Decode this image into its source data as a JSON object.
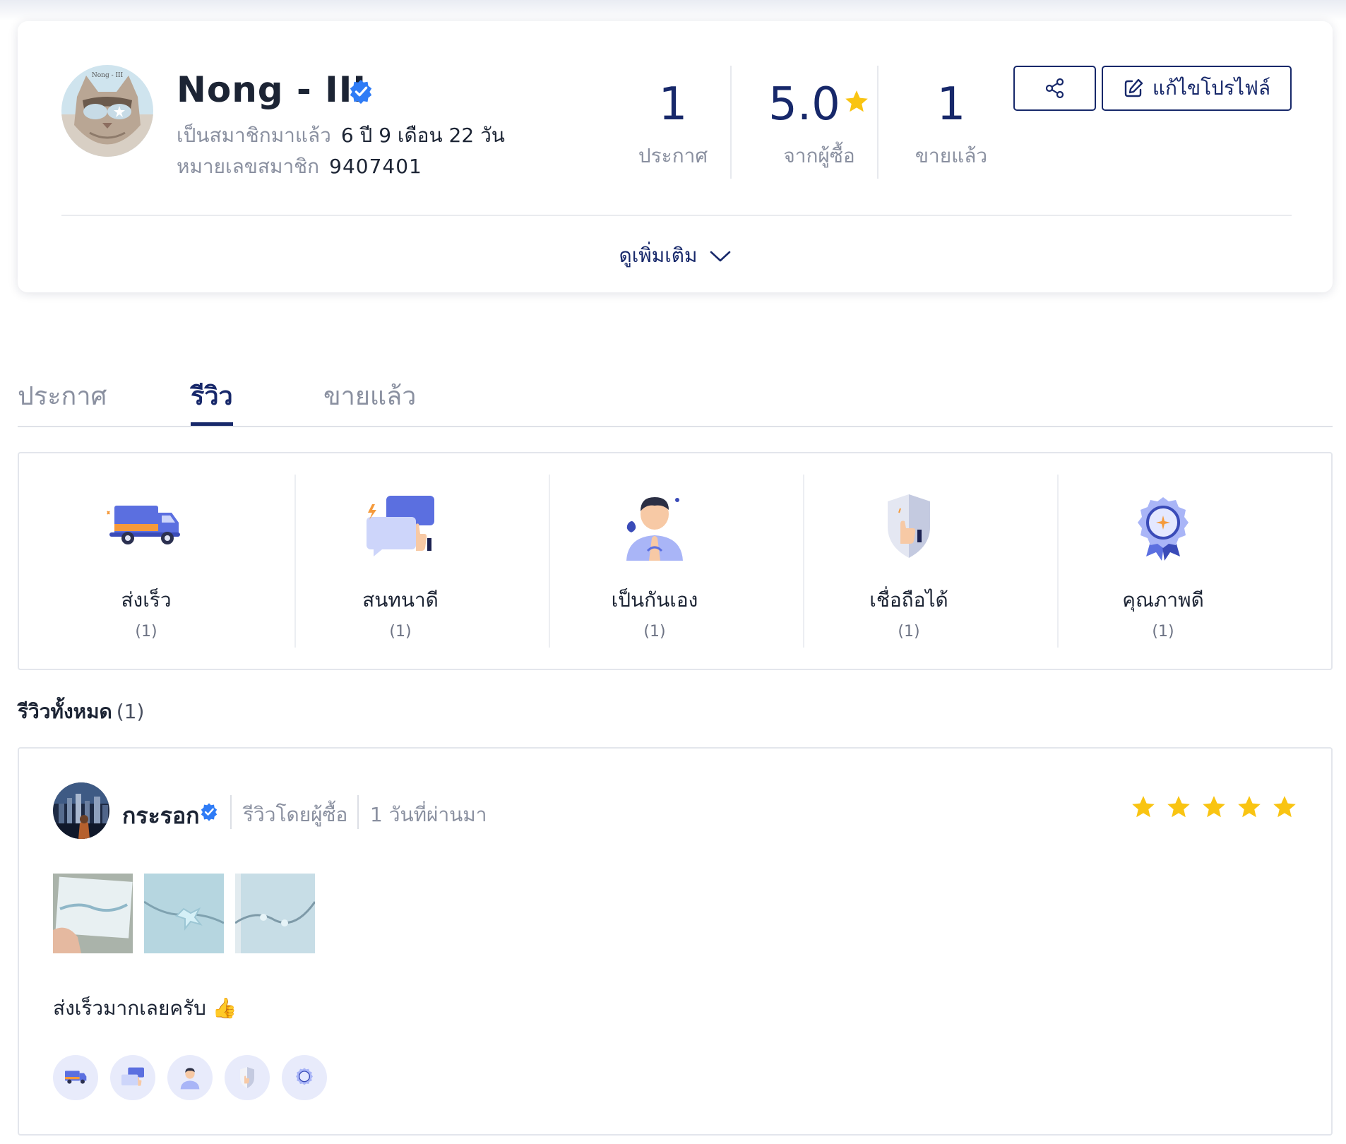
{
  "profile": {
    "name": "Nong - III",
    "avatar_text": "Nong - III",
    "member_since_label": "เป็นสมาชิกมาแล้ว",
    "member_since_value": "6 ปี 9 เดือน 22 วัน",
    "member_id_label": "หมายเลขสมาชิก",
    "member_id_value": "9407401",
    "stats": [
      {
        "value": "1",
        "label": "ประกาศ"
      },
      {
        "value": "5.0",
        "label": "จากผู้ซื้อ"
      },
      {
        "value": "1",
        "label": "ขายแล้ว"
      }
    ],
    "edit_label": "แก้ไขโปรไฟล์",
    "see_more_label": "ดูเพิ่มเติม"
  },
  "tabs": [
    {
      "label": "ประกาศ",
      "active": false
    },
    {
      "label": "รีวิว",
      "active": true
    },
    {
      "label": "ขายแล้ว",
      "active": false
    }
  ],
  "attributes": [
    {
      "name": "ส่งเร็ว",
      "count": "(1)",
      "icon": "delivery-truck-icon"
    },
    {
      "name": "สนทนาดี",
      "count": "(1)",
      "icon": "chat-thumbs-up-icon"
    },
    {
      "name": "เป็นกันเอง",
      "count": "(1)",
      "icon": "friendly-person-icon"
    },
    {
      "name": "เชื่อถือได้",
      "count": "(1)",
      "icon": "shield-thumbs-up-icon"
    },
    {
      "name": "คุณภาพดี",
      "count": "(1)",
      "icon": "quality-badge-icon"
    }
  ],
  "reviews": {
    "title": "รีวิวทั้งหมด",
    "count": "(1)",
    "items": [
      {
        "reviewer": "กระรอก",
        "reviewed_by": "รีวิวโดยผู้ซื้อ",
        "time": "1 วันที่ผ่านมา",
        "rating": 5,
        "text": "ส่งเร็วมากเลยครับ 👍",
        "photo_count": 3,
        "tags": [
          "delivery-truck-icon",
          "chat-thumbs-up-icon",
          "friendly-person-icon",
          "shield-thumbs-up-icon",
          "quality-badge-icon"
        ]
      }
    ]
  },
  "colors": {
    "primary": "#17286a",
    "muted": "#8a90a0",
    "star": "#f9c412",
    "verified": "#2f7cf6"
  }
}
